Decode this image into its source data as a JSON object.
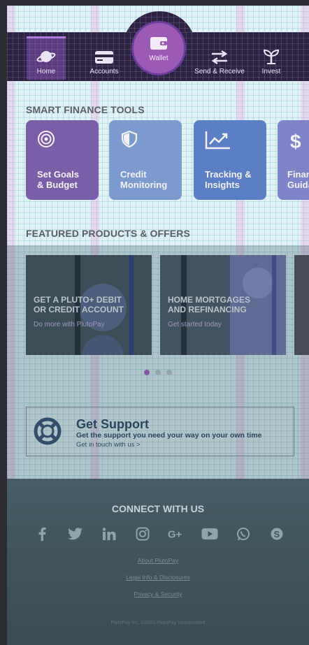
{
  "nav": {
    "items": [
      {
        "label": "Home",
        "icon": "planet-icon"
      },
      {
        "label": "Accounts",
        "icon": "card-icon"
      },
      {
        "label": "Wallet",
        "icon": "wallet-icon"
      },
      {
        "label": "Send & Receive",
        "icon": "transfer-icon"
      },
      {
        "label": "Invest",
        "icon": "plant-icon"
      }
    ],
    "active": "Home"
  },
  "tools": {
    "title": "SMART FINANCE TOOLS",
    "items": [
      {
        "label_1": "Set Goals",
        "label_2": "& Budget",
        "icon": "target-icon",
        "color": "#7a5fa8"
      },
      {
        "label_1": "Credit",
        "label_2": "Monitoring",
        "icon": "shield-icon",
        "color": "#7b9bcf"
      },
      {
        "label_1": "Tracking &",
        "label_2": "Insights",
        "icon": "chart-icon",
        "color": "#5b7fc4"
      },
      {
        "label_1": "Finan",
        "label_2": "Guida",
        "icon": "dollar-icon",
        "color": "#7f83c8"
      }
    ]
  },
  "offers": {
    "title": "FEATURED PRODUCTS & OFFERS",
    "items": [
      {
        "title_1": "GET A PLUTO+ DEBIT",
        "title_2": "OR CREDIT ACCOUNT",
        "subtitle": "Do more with PlutoPay"
      },
      {
        "title_1": "HOME MORTGAGES",
        "title_2": "AND REFINANCING",
        "subtitle": "Get started today"
      }
    ],
    "pages": 3,
    "current_page": 1
  },
  "support": {
    "title": "Get Support",
    "description": "Get the support you need your way on your own time",
    "cta": "Get in touch with us >"
  },
  "footer": {
    "connect_title": "CONNECT WITH US",
    "socials": [
      "facebook-icon",
      "twitter-icon",
      "linkedin-icon",
      "instagram-icon",
      "google-plus-icon",
      "youtube-icon",
      "whatsapp-icon",
      "skype-icon"
    ],
    "links": [
      "About PlutoPay",
      "Legal Info & Disclosures",
      "Privacy & Security"
    ],
    "copyright": "PlutoPay Inc. ©2020 PlutoPay Incorporated"
  },
  "colors": {
    "nav_bg": "#2d2244",
    "wallet_accent": "#9b5bb5",
    "active_dot": "#a857c9"
  }
}
